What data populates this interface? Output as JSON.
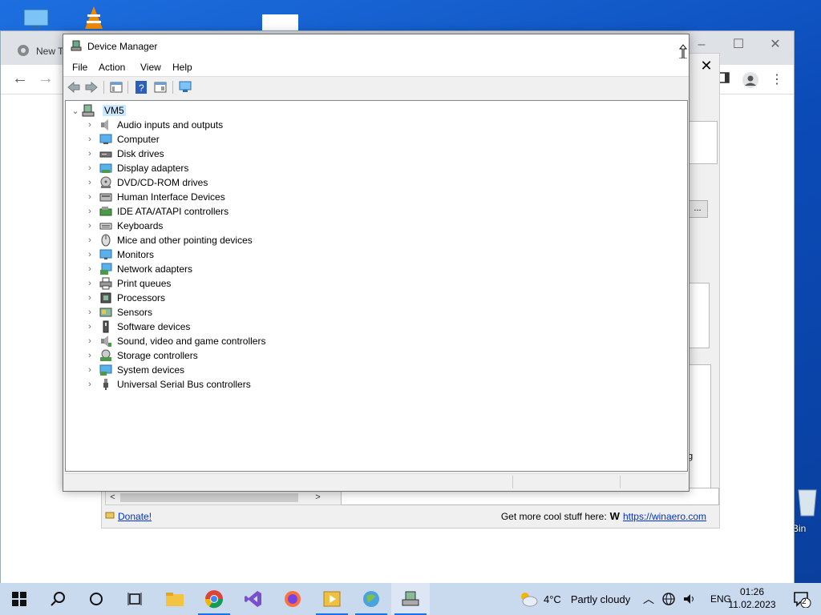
{
  "desktop": {
    "recycle_bin_label": "Bin"
  },
  "chrome": {
    "tab_title": "New Ta",
    "win_controls": [
      "–",
      "☐",
      "✕"
    ]
  },
  "winaero": {
    "close_glyph": "✕",
    "ellipsis_button": "...",
    "donate_link": "Donate!",
    "more_text": "Get more cool stuff here:",
    "winaero_link": "https://winaero.com",
    "truncated_text": "g"
  },
  "device_manager": {
    "title": "Device Manager",
    "menu": [
      "File",
      "Action",
      "View",
      "Help"
    ],
    "root": "VM5",
    "categories": [
      {
        "label": "Audio inputs and outputs",
        "icon": "speaker-icon"
      },
      {
        "label": "Computer",
        "icon": "computer-icon"
      },
      {
        "label": "Disk drives",
        "icon": "disk-drive-icon"
      },
      {
        "label": "Display adapters",
        "icon": "display-adapter-icon"
      },
      {
        "label": "DVD/CD-ROM drives",
        "icon": "dvd-drive-icon"
      },
      {
        "label": "Human Interface Devices",
        "icon": "hid-icon"
      },
      {
        "label": "IDE ATA/ATAPI controllers",
        "icon": "ide-controller-icon"
      },
      {
        "label": "Keyboards",
        "icon": "keyboard-icon"
      },
      {
        "label": "Mice and other pointing devices",
        "icon": "mouse-icon"
      },
      {
        "label": "Monitors",
        "icon": "monitor-icon"
      },
      {
        "label": "Network adapters",
        "icon": "network-adapter-icon"
      },
      {
        "label": "Print queues",
        "icon": "printer-icon"
      },
      {
        "label": "Processors",
        "icon": "processor-icon"
      },
      {
        "label": "Sensors",
        "icon": "sensor-icon"
      },
      {
        "label": "Software devices",
        "icon": "software-device-icon"
      },
      {
        "label": "Sound, video and game controllers",
        "icon": "sound-controller-icon"
      },
      {
        "label": "Storage controllers",
        "icon": "storage-controller-icon"
      },
      {
        "label": "System devices",
        "icon": "system-device-icon"
      },
      {
        "label": "Universal Serial Bus controllers",
        "icon": "usb-icon"
      }
    ]
  },
  "taskbar": {
    "weather_temp": "4°C",
    "weather_text": "Partly cloudy",
    "language": "ENG",
    "time": "01:26",
    "date": "11.02.2023",
    "notification_count": "2"
  },
  "colors": {
    "accent": "#0078d7",
    "selection": "#cce8ff",
    "taskbar": "#c9d9ee"
  }
}
